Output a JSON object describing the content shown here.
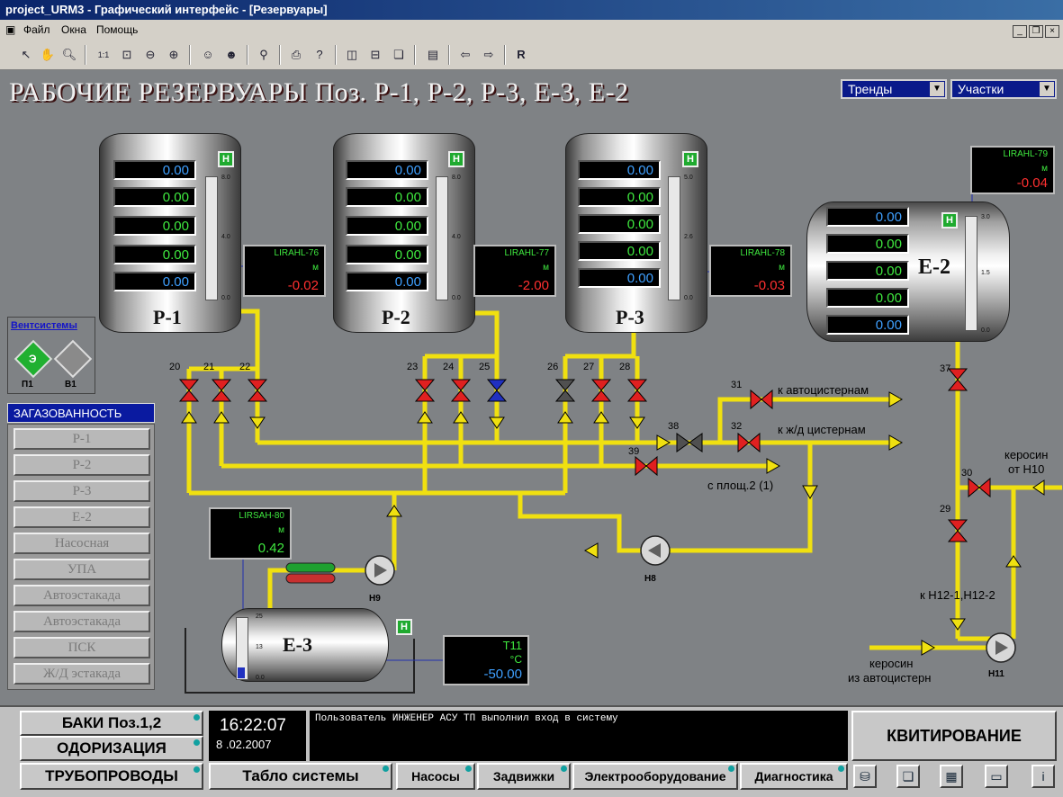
{
  "window": {
    "title": "project_URM3 - Графический интерфейс - [Резервуары]"
  },
  "menu": [
    "Файл",
    "Окна",
    "Помощь"
  ],
  "main": {
    "title": "РАБОЧИЕ РЕЗЕРВУАРЫ Поз. Р-1, Р-2, Р-3, Е-3, Е-2",
    "combo_trends": "Тренды",
    "combo_sections": "Участки"
  },
  "tanks": {
    "p1": {
      "label": "Р-1",
      "values": [
        "0.00",
        "0.00",
        "0.00",
        "0.00",
        "0.00"
      ],
      "scale": [
        "8.0",
        "4.0",
        "0.0"
      ],
      "badge": "Н",
      "lir": {
        "tag": "LIRAHL-76",
        "unit": "м",
        "value": "-0.02"
      }
    },
    "p2": {
      "label": "Р-2",
      "values": [
        "0.00",
        "0.00",
        "0.00",
        "0.00",
        "0.00"
      ],
      "scale": [
        "8.0",
        "4.0",
        "0.0"
      ],
      "badge": "Н",
      "lir": {
        "tag": "LIRAHL-77",
        "unit": "м",
        "value": "-2.00"
      }
    },
    "p3": {
      "label": "Р-3",
      "values": [
        "0.00",
        "0.00",
        "0.00",
        "0.00",
        "0.00"
      ],
      "scale": [
        "5.0",
        "2.6",
        "0.0"
      ],
      "badge": "Н",
      "lir": {
        "tag": "LIRAHL-78",
        "unit": "м",
        "value": "-0.03"
      }
    },
    "e2": {
      "label": "Е-2",
      "values": [
        "0.00",
        "0.00",
        "0.00",
        "0.00",
        "0.00"
      ],
      "scale": [
        "3.0",
        "1.5",
        "0.0"
      ],
      "badge": "Н",
      "lir": {
        "tag": "LIRAHL-79",
        "unit": "м",
        "value": "-0.04"
      }
    },
    "e3": {
      "label": "Е-3",
      "scale": [
        "25",
        "13",
        "0.0"
      ],
      "badge": "Н",
      "lir": {
        "tag": "LIRSAH-80",
        "unit": "м",
        "value": "0.42"
      },
      "temp": {
        "tag": "T11",
        "unit": "°C",
        "value": "-50.00"
      }
    }
  },
  "valves": [
    "20",
    "21",
    "22",
    "23",
    "24",
    "25",
    "26",
    "27",
    "28",
    "31",
    "32",
    "38",
    "39",
    "37",
    "30",
    "29"
  ],
  "pumps": {
    "n9": "Н9",
    "n8": "Н8",
    "n11": "Н11"
  },
  "flow_labels": {
    "auto_tanks": "к автоцистернам",
    "rail_tanks": "к ж/д цистернам",
    "from_site2": "с площ.2 (1)",
    "kerosene_n10_1": "керосин",
    "kerosene_n10_2": "от Н10",
    "to_n12": "к Н12-1,Н12-2",
    "kerosene_auto_1": "керосин",
    "kerosene_auto_2": "из автоцистерн"
  },
  "vent": {
    "title": "Вентсистемы",
    "p1_symbol": "Э",
    "p1_label": "П1",
    "v1_label": "В1"
  },
  "gas": {
    "title": "ЗАГАЗОВАННОСТЬ",
    "items": [
      "Р-1",
      "Р-2",
      "Р-3",
      "Е-2",
      "Насосная",
      "УПА",
      "Автоэстакада",
      "Автоэстакада",
      "ПСК",
      "Ж/Д эстакада"
    ]
  },
  "bottom": {
    "baki": "БАКИ Поз.1,2",
    "odor": "ОДОРИЗАЦИЯ",
    "pipes": "ТРУБОПРОВОДЫ",
    "time": "16:22:07",
    "date": "8 .02.2007",
    "message": "Пользователь ИНЖЕНЕР АСУ ТП выполнил вход в систему",
    "ack": "КВИТИРОВАНИЕ",
    "tabs": [
      "Табло системы",
      "Насосы",
      "Задвижки",
      "Электрооборудование",
      "Диагностика"
    ]
  },
  "colors": {
    "pipe": "#f0e010",
    "valve_open": "#e02020",
    "valve_closed_blue": "#2030c0",
    "valve_gray": "#505050"
  }
}
